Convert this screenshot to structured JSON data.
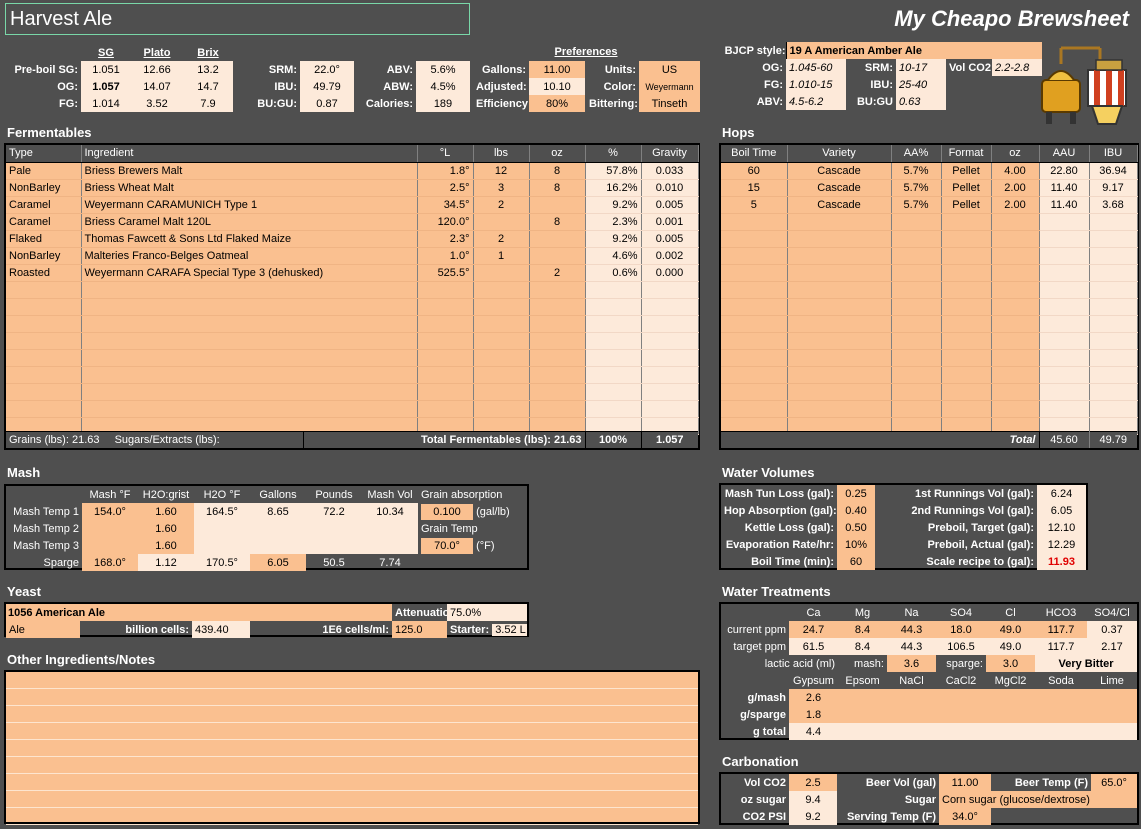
{
  "header": {
    "recipe_name": "Harvest Ale",
    "brand": "My Cheapo Brewsheet"
  },
  "gravity": {
    "headers": [
      "SG",
      "Plato",
      "Brix"
    ],
    "rows": [
      {
        "label": "Pre-boil SG:",
        "sg": "1.051",
        "plato": "12.66",
        "brix": "13.2"
      },
      {
        "label": "OG:",
        "sg": "1.057",
        "plato": "14.07",
        "brix": "14.7"
      },
      {
        "label": "FG:",
        "sg": "1.014",
        "plato": "3.52",
        "brix": "7.9"
      }
    ]
  },
  "stats": [
    {
      "label": "SRM:",
      "value": "22.0°"
    },
    {
      "label": "IBU:",
      "value": "49.79"
    },
    {
      "label": "BU:GU:",
      "value": "0.87"
    }
  ],
  "stats2": [
    {
      "label": "ABV:",
      "value": "5.6%"
    },
    {
      "label": "ABW:",
      "value": "4.5%"
    },
    {
      "label": "Calories:",
      "value": "189"
    }
  ],
  "volumes": [
    {
      "label": "Gallons:",
      "value": "11.00"
    },
    {
      "label": "Adjusted:",
      "value": "10.10"
    },
    {
      "label": "Efficiency:",
      "value": "80%"
    }
  ],
  "preferences": {
    "title": "Preferences",
    "items": [
      {
        "label": "Units:",
        "value": "US"
      },
      {
        "label": "Color:",
        "value": "Weyermann"
      },
      {
        "label": "Bittering:",
        "value": "Tinseth"
      }
    ]
  },
  "bjcp": {
    "label": "BJCP style:",
    "style": "19 A American Amber Ale",
    "og_label": "OG:",
    "og": "1.045-60",
    "srm_label": "SRM:",
    "srm": "10-17",
    "vol_label": "Vol CO2:",
    "vol": "2.2-2.8",
    "fg_label": "FG:",
    "fg": "1.010-15",
    "ibu_label": "IBU:",
    "ibu": "25-40",
    "abv_label": "ABV:",
    "abv": "4.5-6.2",
    "bugu_label": "BU:GU",
    "bugu": "0.63"
  },
  "fermentables": {
    "title": "Fermentables",
    "headers": [
      "Type",
      "Ingredient",
      "°L",
      "lbs",
      "oz",
      "%",
      "Gravity"
    ],
    "rows": [
      [
        "Pale",
        "Briess Brewers Malt",
        "1.8°",
        "12",
        "8",
        "57.8%",
        "0.033"
      ],
      [
        "NonBarley",
        "Briess Wheat Malt",
        "2.5°",
        "3",
        "8",
        "16.2%",
        "0.010"
      ],
      [
        "Caramel",
        "Weyermann CARAMUNICH Type 1",
        "34.5°",
        "2",
        "",
        "9.2%",
        "0.005"
      ],
      [
        "Caramel",
        "Briess Caramel Malt 120L",
        "120.0°",
        "",
        "8",
        "2.3%",
        "0.001"
      ],
      [
        "Flaked",
        "Thomas Fawcett & Sons Ltd Flaked Maize",
        "2.3°",
        "2",
        "",
        "9.2%",
        "0.005"
      ],
      [
        "NonBarley",
        "Malteries Franco-Belges Oatmeal",
        "1.0°",
        "1",
        "",
        "4.6%",
        "0.002"
      ],
      [
        "Roasted",
        "Weyermann CARAFA Special Type 3 (dehusked)",
        "525.5°",
        "",
        "2",
        "0.6%",
        "0.000"
      ]
    ],
    "footer": {
      "grains_label": "Grains (lbs):",
      "grains": "21.63",
      "sugars_label": "Sugars/Extracts (lbs):",
      "sugars": "",
      "total_label": "Total Fermentables (lbs):",
      "total": "21.63",
      "pct": "100%",
      "gravity": "1.057"
    }
  },
  "hops": {
    "title": "Hops",
    "headers": [
      "Boil Time",
      "Variety",
      "AA%",
      "Format",
      "oz",
      "AAU",
      "IBU"
    ],
    "rows": [
      [
        "60",
        "Cascade",
        "5.7%",
        "Pellet",
        "4.00",
        "22.80",
        "36.94"
      ],
      [
        "15",
        "Cascade",
        "5.7%",
        "Pellet",
        "2.00",
        "11.40",
        "9.17"
      ],
      [
        "5",
        "Cascade",
        "5.7%",
        "Pellet",
        "2.00",
        "11.40",
        "3.68"
      ]
    ],
    "footer": {
      "label": "Total",
      "aau": "45.60",
      "ibu": "49.79"
    }
  },
  "mash": {
    "title": "Mash",
    "headers": [
      "Mash °F",
      "H2O:grist",
      "H2O °F",
      "Gallons",
      "Pounds",
      "Mash Vol"
    ],
    "rows": [
      {
        "label": "Mash Temp 1",
        "cells": [
          "154.0°",
          "1.60",
          "164.5°",
          "8.65",
          "72.2",
          "10.34"
        ]
      },
      {
        "label": "Mash Temp 2",
        "cells": [
          "",
          "1.60",
          "",
          "",
          "",
          ""
        ]
      },
      {
        "label": "Mash Temp 3",
        "cells": [
          "",
          "1.60",
          "",
          "",
          "",
          ""
        ]
      },
      {
        "label": "Sparge",
        "cells": [
          "168.0°",
          "1.12",
          "170.5°",
          "6.05",
          "50.5",
          "7.74"
        ]
      }
    ],
    "absorption_label": "Grain absorption",
    "absorption": "0.100",
    "absorption_unit": "(gal/lb)",
    "grain_temp_label": "Grain Temp",
    "grain_temp": "70.0°",
    "grain_temp_unit": "(°F)"
  },
  "yeast": {
    "title": "Yeast",
    "name": "1056 American Ale",
    "attenuation_label": "Attenuation:",
    "attenuation": "75.0%",
    "type": "Ale",
    "cells_label": "billion cells:",
    "cells": "439.40",
    "density_label": "1E6 cells/ml:",
    "density": "125.0",
    "starter_label": "Starter:",
    "starter": "3.52 L"
  },
  "notes": {
    "title": "Other Ingredients/Notes"
  },
  "water_volumes": {
    "title": "Water Volumes",
    "left": [
      {
        "label": "Mash Tun Loss (gal):",
        "value": "0.25"
      },
      {
        "label": "Hop Absorption (gal):",
        "value": "0.40"
      },
      {
        "label": "Kettle Loss (gal):",
        "value": "0.50"
      },
      {
        "label": "Evaporation Rate/hr:",
        "value": "10%"
      },
      {
        "label": "Boil Time (min):",
        "value": "60"
      }
    ],
    "right": [
      {
        "label": "1st Runnings Vol (gal):",
        "value": "6.24"
      },
      {
        "label": "2nd Runnings Vol (gal):",
        "value": "6.05"
      },
      {
        "label": "Preboil, Target (gal):",
        "value": "12.10"
      },
      {
        "label": "Preboil, Actual (gal):",
        "value": "12.29"
      },
      {
        "label": "Scale recipe to (gal):",
        "value": "11.93"
      }
    ]
  },
  "water_treatments": {
    "title": "Water Treatments",
    "ion_headers": [
      "Ca",
      "Mg",
      "Na",
      "SO4",
      "Cl",
      "HCO3",
      "SO4/Cl"
    ],
    "current_label": "current ppm",
    "current": [
      "24.7",
      "8.4",
      "44.3",
      "18.0",
      "49.0",
      "117.7",
      "0.37"
    ],
    "target_label": "target ppm",
    "target": [
      "61.5",
      "8.4",
      "44.3",
      "106.5",
      "49.0",
      "117.7",
      "2.17"
    ],
    "lactic_label": "lactic acid (ml)",
    "mash_label": "mash:",
    "mash": "3.6",
    "sparge_label": "sparge:",
    "sparge": "3.0",
    "bitterness": "Very Bitter",
    "salt_headers": [
      "Gypsum",
      "Epsom",
      "NaCl",
      "CaCl2",
      "MgCl2",
      "Soda",
      "Lime"
    ],
    "salt_rows": [
      {
        "label": "g/mash",
        "values": [
          "2.6",
          "",
          "",
          "",
          "",
          "",
          ""
        ]
      },
      {
        "label": "g/sparge",
        "values": [
          "1.8",
          "",
          "",
          "",
          "",
          "",
          ""
        ]
      },
      {
        "label": "g total",
        "values": [
          "4.4",
          "",
          "",
          "",
          "",
          "",
          ""
        ]
      }
    ]
  },
  "carbonation": {
    "title": "Carbonation",
    "vol_label": "Vol CO2",
    "vol": "2.5",
    "beer_vol_label": "Beer Vol (gal)",
    "beer_vol": "11.00",
    "beer_temp_label": "Beer Temp (F)",
    "beer_temp": "65.0°",
    "oz_sugar_label": "oz sugar",
    "oz_sugar": "9.4",
    "sugar_label": "Sugar",
    "sugar": "Corn sugar (glucose/dextrose)",
    "psi_label": "CO2 PSI",
    "psi": "9.2",
    "serving_label": "Serving Temp (F)",
    "serving": "34.0°"
  }
}
